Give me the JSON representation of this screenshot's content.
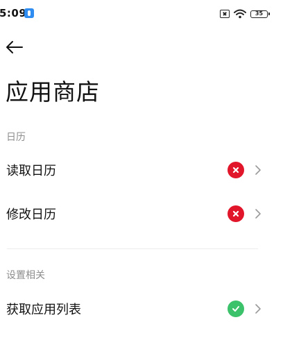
{
  "status_bar": {
    "time": "5:09",
    "battery": "35"
  },
  "page": {
    "title": "应用商店"
  },
  "sections": [
    {
      "header": "日历",
      "items": [
        {
          "label": "读取日历",
          "status": "denied"
        },
        {
          "label": "修改日历",
          "status": "denied"
        }
      ]
    },
    {
      "header": "设置相关",
      "items": [
        {
          "label": "获取应用列表",
          "status": "allowed"
        }
      ]
    }
  ],
  "colors": {
    "denied": "#e2162b",
    "allowed": "#3cc26a"
  },
  "icons": {
    "back": "back-arrow-icon",
    "denied": "x-icon",
    "allowed": "check-icon",
    "row_action": "chevron-right-icon"
  }
}
